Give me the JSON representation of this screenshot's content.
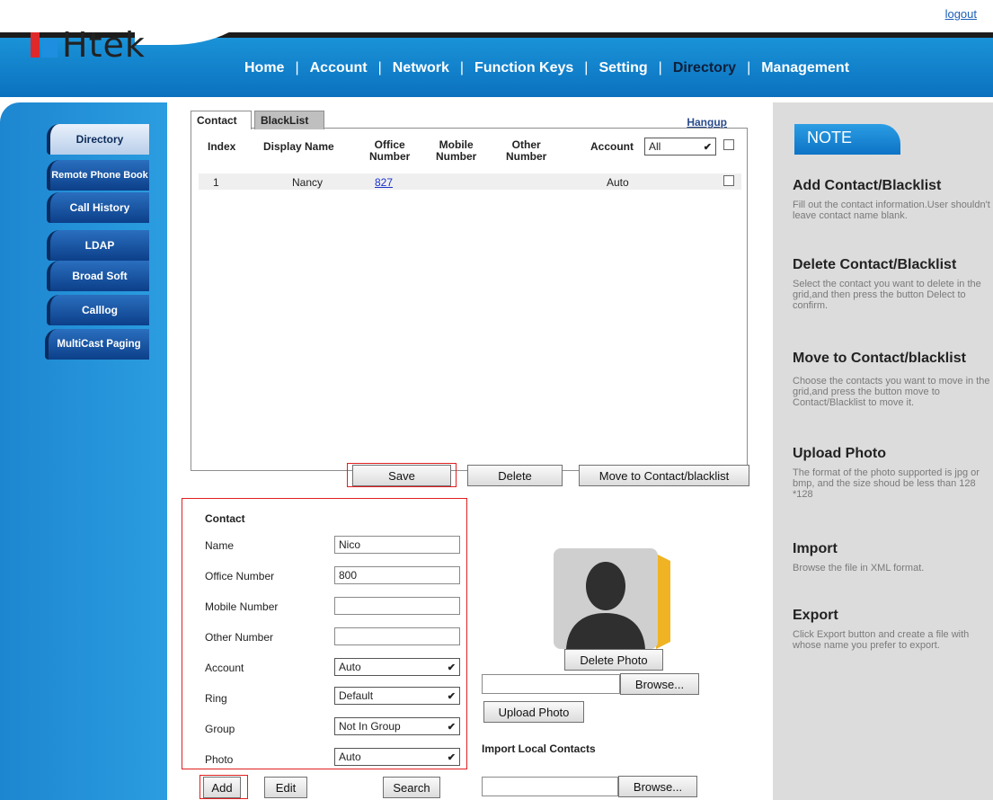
{
  "header": {
    "logout": "logout",
    "logo_text": "Htek",
    "nav": [
      "Home",
      "Account",
      "Network",
      "Function Keys",
      "Setting",
      "Directory",
      "Management"
    ],
    "active_nav": "Directory"
  },
  "sidebar": {
    "items": [
      {
        "label": "Directory",
        "active": true
      },
      {
        "label": "Remote Phone Book",
        "active": false
      },
      {
        "label": "Call History",
        "active": false
      },
      {
        "label": "LDAP",
        "active": false
      },
      {
        "label": "Broad Soft",
        "active": false
      },
      {
        "label": "Calllog",
        "active": false
      },
      {
        "label": "MultiCast Paging",
        "active": false
      }
    ]
  },
  "grid": {
    "tabs": [
      "Contact",
      "BlackList"
    ],
    "hangup": "Hangup",
    "columns": {
      "index": "Index",
      "display_name": "Display Name",
      "office_1": "Office",
      "office_2": "Number",
      "mobile_1": "Mobile",
      "mobile_2": "Number",
      "other_1": "Other",
      "other_2": "Number",
      "account": "Account"
    },
    "account_filter": "All",
    "rows": [
      {
        "index": "1",
        "name": "Nancy",
        "office": "827",
        "mobile": "",
        "other": "",
        "account": "Auto"
      }
    ],
    "buttons": {
      "save": "Save",
      "delete": "Delete",
      "move": "Move to Contact/blacklist"
    }
  },
  "form": {
    "title": "Contact",
    "name_label": "Name",
    "name_value": "Nico",
    "office_label": "Office Number",
    "office_value": "800",
    "mobile_label": "Mobile Number",
    "mobile_value": "",
    "other_label": "Other Number",
    "other_value": "",
    "account_label": "Account",
    "account_value": "Auto",
    "ring_label": "Ring",
    "ring_value": "Default",
    "group_label": "Group",
    "group_value": "Not In Group",
    "photo_label": "Photo",
    "photo_value": "Auto",
    "buttons": {
      "add": "Add",
      "edit": "Edit",
      "search": "Search"
    }
  },
  "photo": {
    "delete_photo": "Delete Photo",
    "browse": "Browse...",
    "upload_photo": "Upload Photo",
    "import_title": "Import Local Contacts",
    "import_browse": "Browse..."
  },
  "notes": {
    "tab": "NOTE",
    "sections": [
      {
        "heading": "Add Contact/Blacklist",
        "body": "Fill out the contact information.User shouldn't leave contact name blank."
      },
      {
        "heading": "Delete Contact/Blacklist",
        "body": "Select the contact you want to delete in the grid,and then press the button Delect to confirm."
      },
      {
        "heading": "Move to Contact/blacklist",
        "body": "Choose the contacts you want to move in the grid,and press the button move to Contact/Blacklist to move it."
      },
      {
        "heading": "Upload Photo",
        "body": "The format of the photo supported is jpg or bmp, and the size shoud be less than 128 *128"
      },
      {
        "heading": "Import",
        "body": "Browse the file in XML format."
      },
      {
        "heading": "Export",
        "body": "Click Export button and create a file with whose name you prefer to export."
      }
    ]
  },
  "colors": {
    "header_blue": "#0b71bf",
    "sidebar_blue": "#1d86d0",
    "highlight_red": "#e01f1f",
    "note_bg": "#dcdcdc"
  }
}
